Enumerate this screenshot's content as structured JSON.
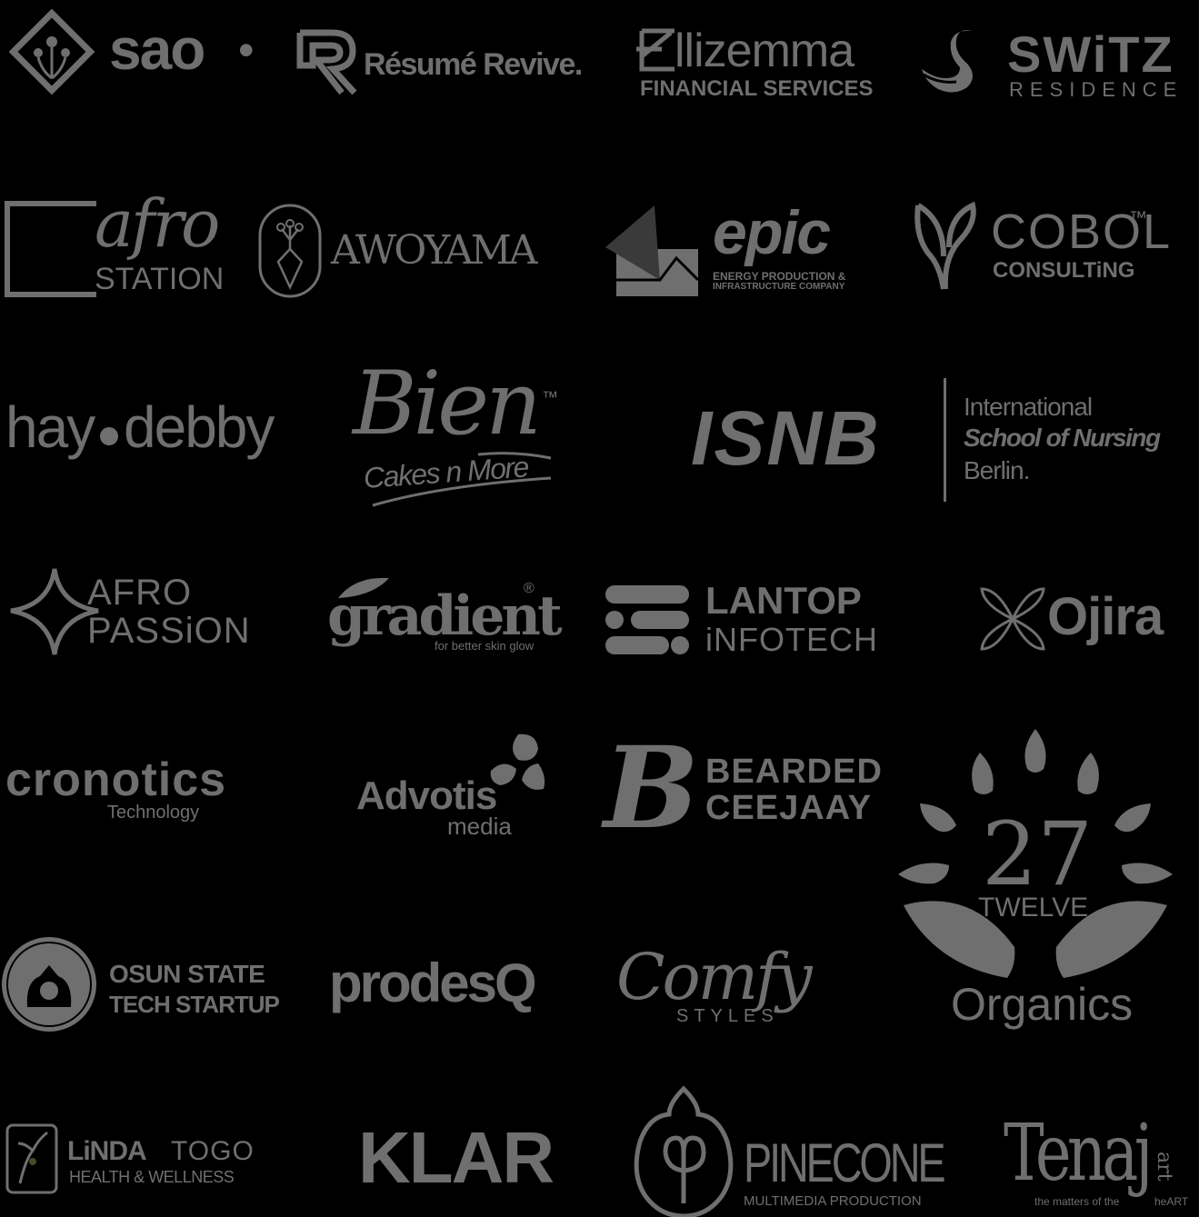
{
  "logos": {
    "sao": {
      "name": "sao",
      "dot": "•"
    },
    "resume": {
      "name": "Résumé Revive."
    },
    "ellizemma": {
      "name": "llizemma",
      "sub": "FINANCIAL SERVICES"
    },
    "switz": {
      "name": "SWiTZ",
      "sub": "RESIDENCE"
    },
    "afro_station": {
      "top": "afro",
      "bottom": "STATION"
    },
    "awoyama": {
      "name": "AWOYAMA"
    },
    "epic": {
      "name": "epic",
      "sub1": "ENERGY PRODUCTION &",
      "sub2": "INFRASTRUCTURE COMPANY"
    },
    "cobol": {
      "name": "COBOL",
      "tm": "™",
      "sub": "CONSULTiNG"
    },
    "haydebby": {
      "left": "hay",
      "right": "debby"
    },
    "bien": {
      "name": "Bien",
      "tm": "™",
      "sub": "Cakes n More"
    },
    "isnb": {
      "name": "ISNB",
      "line1": "International",
      "line2": "School of Nursing",
      "line3": "Berlin."
    },
    "afro_passion": {
      "top": "AFRO",
      "bottom": "PASSiON"
    },
    "gradient": {
      "name": "gradient",
      "reg": "®",
      "sub": "for better skin glow"
    },
    "lantop": {
      "top": "LANTOP",
      "bottom": "iNFOTECH"
    },
    "ojira": {
      "name": "Ojira"
    },
    "cronotics": {
      "name": "cronotics",
      "sub": "Technology"
    },
    "advotis": {
      "name": "Advotis",
      "sub": "media"
    },
    "bearded": {
      "top": "BEARDED",
      "bottom": "CEEJAAY"
    },
    "twentyseven": {
      "num": "27",
      "mid": "TWELVE",
      "bottom": "Organics"
    },
    "osun": {
      "top": "OSUN STATE",
      "bottom": "TECH STARTUP"
    },
    "prodesq": {
      "name": "prodesQ"
    },
    "comfy": {
      "name": "Comfy",
      "sub": "STYLES"
    },
    "linda": {
      "name_a": "LiNDA",
      "name_b": "TOGO",
      "sub": "HEALTH & WELLNESS"
    },
    "klar": {
      "name": "KLAR"
    },
    "pinecone": {
      "name": "PINECONE",
      "sub": "MULTIMEDIA PRODUCTION"
    },
    "tenaj": {
      "name": "Tenaj",
      "side": "art",
      "sub": "the matters of the",
      "sub2": "heART"
    }
  },
  "colors": {
    "background": "#000000",
    "logo": "#6f6f6f",
    "dark": "#3a3a3a"
  }
}
